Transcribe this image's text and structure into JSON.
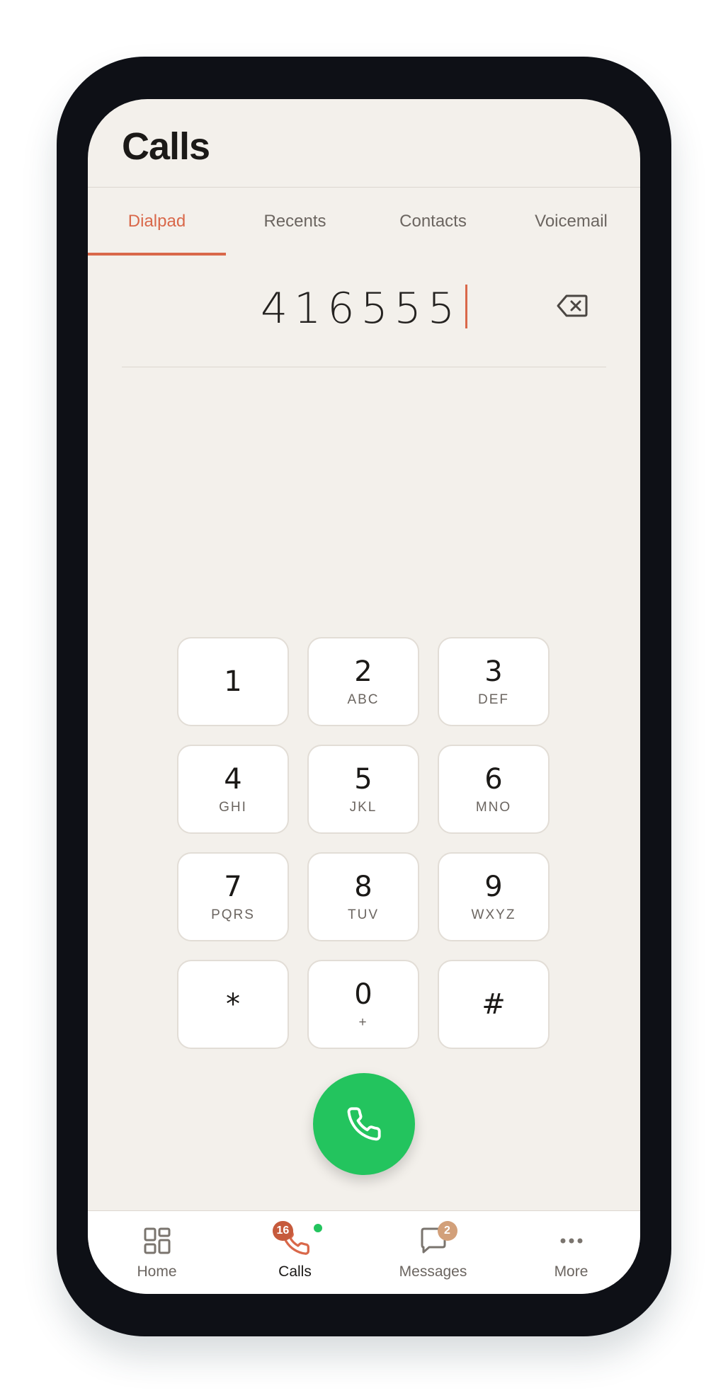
{
  "app": {
    "title": "Calls"
  },
  "tabs": [
    {
      "label": "Dialpad",
      "active": true
    },
    {
      "label": "Recents",
      "active": false
    },
    {
      "label": "Contacts",
      "active": false
    },
    {
      "label": "Voicemail",
      "active": false
    }
  ],
  "dialer": {
    "number": "416555",
    "backspace_icon": "backspace-icon"
  },
  "keypad": [
    {
      "digit": "1",
      "letters": ""
    },
    {
      "digit": "2",
      "letters": "ABC"
    },
    {
      "digit": "3",
      "letters": "DEF"
    },
    {
      "digit": "4",
      "letters": "GHI"
    },
    {
      "digit": "5",
      "letters": "JKL"
    },
    {
      "digit": "6",
      "letters": "MNO"
    },
    {
      "digit": "7",
      "letters": "PQRS"
    },
    {
      "digit": "8",
      "letters": "TUV"
    },
    {
      "digit": "9",
      "letters": "WXYZ"
    },
    {
      "digit": "*",
      "letters": ""
    },
    {
      "digit": "0",
      "letters": "+"
    },
    {
      "digit": "#",
      "letters": ""
    }
  ],
  "call_button": {
    "icon": "phone-icon"
  },
  "bottom_nav": [
    {
      "label": "Home",
      "icon": "grid-icon",
      "active": false
    },
    {
      "label": "Calls",
      "icon": "phone-icon",
      "active": true,
      "badge": "16",
      "status": "online"
    },
    {
      "label": "Messages",
      "icon": "chat-bubble-icon",
      "active": false,
      "badge": "2"
    },
    {
      "label": "More",
      "icon": "more-dots-icon",
      "active": false
    }
  ],
  "colors": {
    "accent": "#d9684a",
    "call_green": "#23c45e",
    "background": "#f3f0eb",
    "badge_calls": "#c65a3c",
    "badge_messages": "#d2a07a"
  }
}
